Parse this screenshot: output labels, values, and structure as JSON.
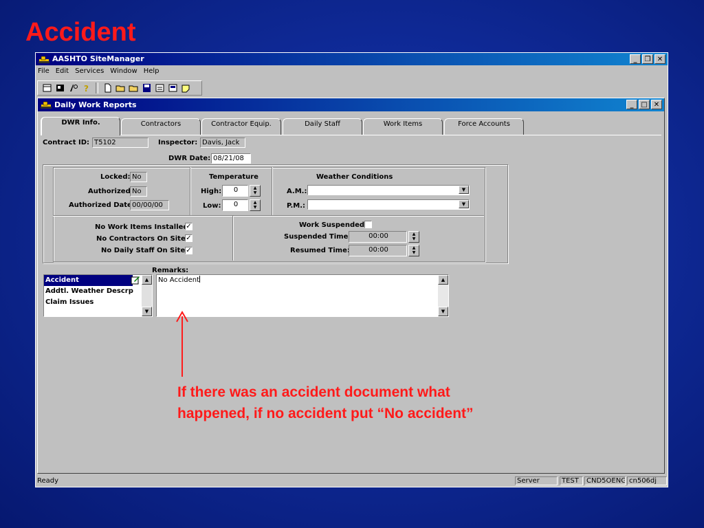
{
  "slide": {
    "title": "Accident",
    "annotation": "If there was an accident document what happened, if no accident put “No accident”"
  },
  "app": {
    "title": "AASHTO SiteManager",
    "menu": [
      "File",
      "Edit",
      "Services",
      "Window",
      "Help"
    ],
    "window_buttons": {
      "minimize": "_",
      "restore": "❒",
      "close": "✕"
    }
  },
  "child": {
    "title": "Daily Work Reports",
    "window_buttons": {
      "minimize": "_",
      "maximize": "□",
      "close": "✕"
    },
    "tabs": [
      "DWR Info.",
      "Contractors",
      "Contractor Equip.",
      "Daily Staff",
      "Work Items",
      "Force Accounts"
    ],
    "active_tab": "DWR Info."
  },
  "header": {
    "contract_label": "Contract ID:",
    "contract_value": "T5102",
    "inspector_label": "Inspector:",
    "inspector_value": "Davis, Jack",
    "dwr_date_label": "DWR Date:",
    "dwr_date_value": "08/21/08"
  },
  "status": {
    "locked_label": "Locked:",
    "locked_value": "No",
    "authorized_label": "Authorized:",
    "authorized_value": "No",
    "authorized_date_label": "Authorized Date:",
    "authorized_date_value": "00/00/00"
  },
  "temperature": {
    "title": "Temperature",
    "high_label": "High:",
    "high_value": "0",
    "low_label": "Low:",
    "low_value": "0"
  },
  "weather": {
    "title": "Weather Conditions",
    "am_label": "A.M.:",
    "am_value": "",
    "pm_label": "P.M.:",
    "pm_value": ""
  },
  "flags": {
    "no_work_items_label": "No Work Items Installed:",
    "no_work_items_checked": true,
    "no_contractors_label": "No Contractors On Site:",
    "no_contractors_checked": true,
    "no_daily_staff_label": "No Daily Staff On Site:",
    "no_daily_staff_checked": true
  },
  "suspension": {
    "work_suspended_label": "Work Suspended:",
    "work_suspended_checked": false,
    "suspended_time_label": "Suspended Time:",
    "suspended_time_value": "00:00",
    "resumed_time_label": "Resumed Time:",
    "resumed_time_value": "00:00"
  },
  "remarks": {
    "label": "Remarks:",
    "categories": [
      "Accident",
      "Addtl. Weather Descrp",
      "Claim Issues"
    ],
    "selected_category": "Accident",
    "text": "No Accident"
  },
  "statusbar": {
    "ready": "Ready",
    "cells": [
      "Server",
      "TEST",
      "CND5OENG",
      "cn506dj"
    ]
  },
  "colors": {
    "slide_background": "#0f2a98",
    "accent_red": "#ff1a1a",
    "titlebar": "#000080",
    "window_face": "#c0c0c0"
  }
}
